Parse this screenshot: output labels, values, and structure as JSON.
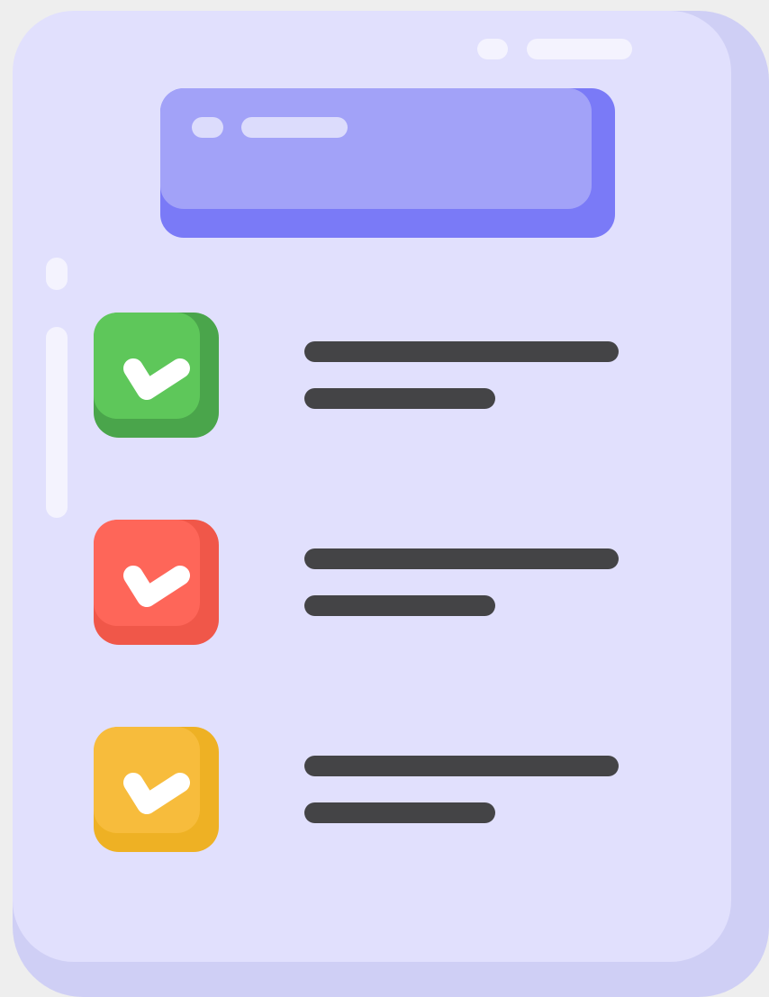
{
  "illustration": {
    "subject": "checklist",
    "palette": {
      "page": "#e1e0fd",
      "page_shadow": "#cfcff5",
      "header": "#a2a2f8",
      "header_shadow": "#7a7af7",
      "line": "#444446",
      "highlight": "#f4f3fe",
      "check": "#ffffff"
    },
    "items": [
      {
        "state": "checked",
        "color": "#5ec75a",
        "shade": "#4aa54b",
        "icon": "check-icon"
      },
      {
        "state": "checked",
        "color": "#fe6659",
        "shade": "#f05749",
        "icon": "check-icon"
      },
      {
        "state": "checked",
        "color": "#f7bc3c",
        "shade": "#eeb124",
        "icon": "check-icon"
      }
    ]
  }
}
